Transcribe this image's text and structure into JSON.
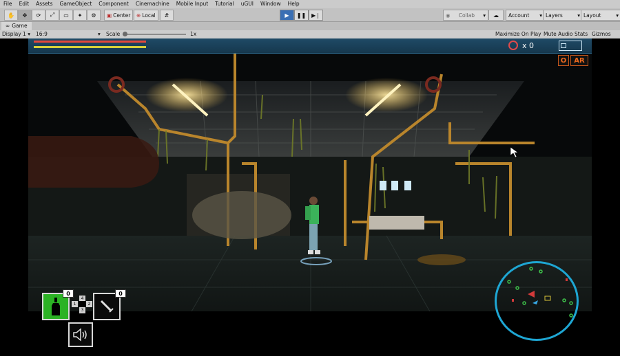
{
  "menu": [
    "File",
    "Edit",
    "Assets",
    "GameObject",
    "Component",
    "Cinemachine",
    "Mobile Input",
    "Tutorial",
    "uGUI",
    "Window",
    "Help"
  ],
  "toolbar": {
    "pivot_center": "Center",
    "pivot_local": "Local",
    "collab": "Collab",
    "account": "Account",
    "layers": "Layers",
    "layout": "Layout"
  },
  "tab": {
    "title": "Game"
  },
  "game_toolbar": {
    "display": "Display 1",
    "aspect": "16:9",
    "scale_label": "Scale",
    "scale_value": "1x",
    "maximize": "Maximize On Play",
    "mute": "Mute Audio",
    "stats": "Stats",
    "gizmos": "Gizmos"
  },
  "hud": {
    "health_color": "#e4483c",
    "stamina_color": "#d8d23a",
    "coin_count": "x 0",
    "badges": [
      "O",
      "AR"
    ]
  },
  "inventory": {
    "slots": [
      {
        "icon": "bottle-icon",
        "count": "0"
      },
      {
        "icon": "knife-icon",
        "count": "0"
      }
    ],
    "keys": [
      "1",
      "2",
      "3",
      "4"
    ],
    "sound_icon": "speaker-icon"
  },
  "colors": {
    "accent": "#3a6fb4",
    "minimap_ring": "#1ea6d3"
  }
}
